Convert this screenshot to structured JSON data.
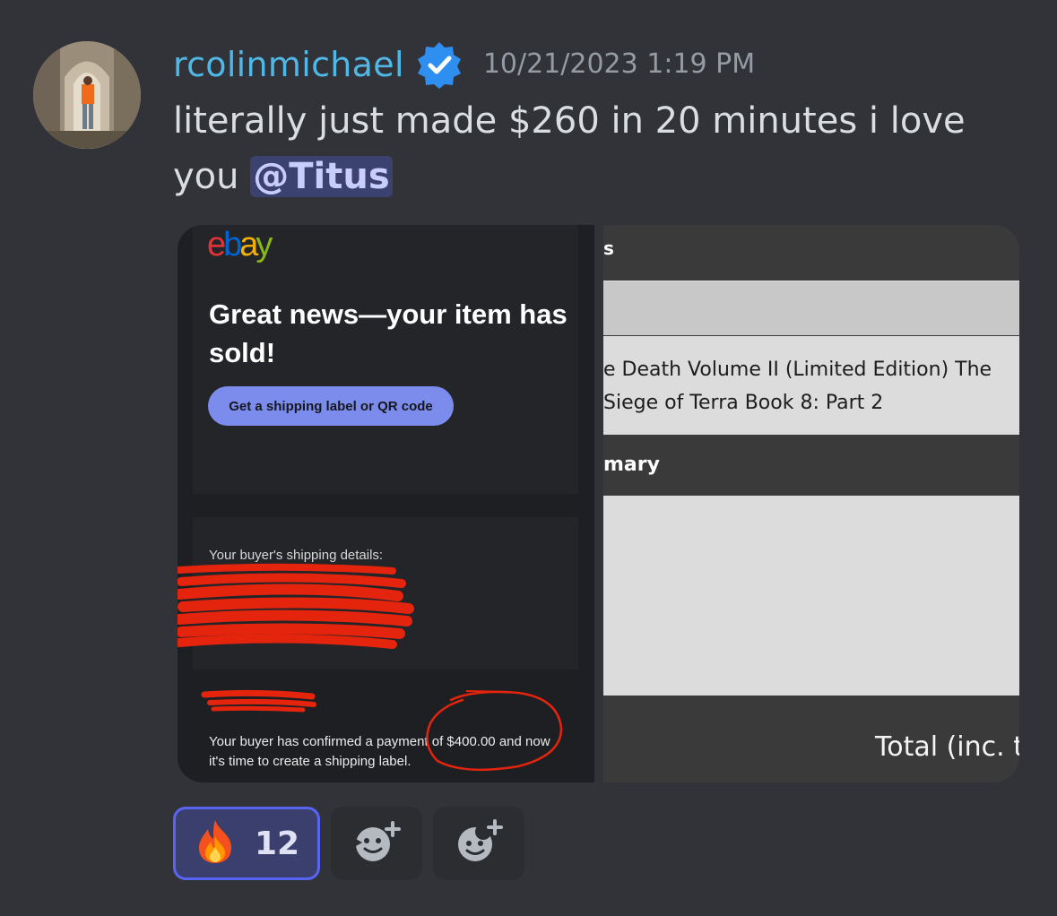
{
  "message": {
    "username": "rcolinmichael",
    "verified": true,
    "timestamp": "10/21/2023 1:19 PM",
    "text_before_mention": "literally just made $260 in 20 minutes i love you ",
    "mention": "@Titus"
  },
  "attachments": {
    "ebay_email": {
      "logo_letters": [
        "e",
        "b",
        "a",
        "y"
      ],
      "logo_colors": [
        "#e53238",
        "#0064d2",
        "#f5af02",
        "#86b817"
      ],
      "headline": "Great news—your item has sold!",
      "button_label": "Get a shipping label or QR code",
      "shipping_details_label": "Your buyer's shipping details:",
      "payment_text": "Your buyer has confirmed a payment of $400.00 and now it's time to create a shipping label."
    },
    "order_page": {
      "top_fragment": "s",
      "item_line1": "e Death Volume II (Limited Edition) The",
      "item_line2": "Siege of Terra Book 8: Part 2",
      "summary_fragment": "mary",
      "total_fragment": "Total (inc. t"
    }
  },
  "reactions": [
    {
      "emoji": "🔥",
      "emoji_name": "fire",
      "count": "12",
      "active": true
    },
    {
      "icon": "add-reaction-icon"
    },
    {
      "icon": "add-super-reaction-icon"
    }
  ],
  "colors": {
    "username": "#4fb8e6",
    "mention_bg": "#3c4270",
    "accent": "#5865f2",
    "scribble": "#e5240e"
  }
}
